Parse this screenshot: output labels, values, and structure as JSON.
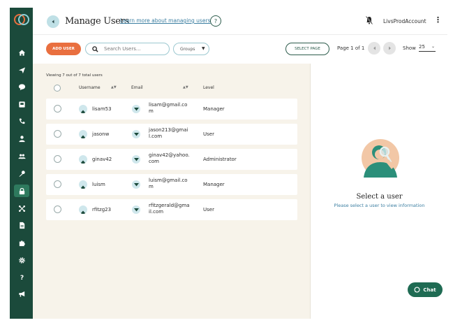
{
  "sidebar": {
    "items": [
      {
        "icon": "home-icon"
      },
      {
        "icon": "send-icon"
      },
      {
        "icon": "chat-bubble-icon"
      },
      {
        "icon": "inbox-icon"
      },
      {
        "icon": "phone-icon"
      },
      {
        "icon": "user-icon"
      },
      {
        "icon": "users-icon"
      },
      {
        "icon": "key-icon"
      },
      {
        "icon": "lock-icon",
        "active": true
      },
      {
        "icon": "network-icon"
      },
      {
        "icon": "document-icon"
      },
      {
        "icon": "puzzle-icon"
      },
      {
        "icon": "gear-icon"
      },
      {
        "icon": "help-icon"
      },
      {
        "icon": "megaphone-icon"
      }
    ]
  },
  "header": {
    "title": "Manage Users",
    "learn_link": "Learn more about managing users",
    "help": "?",
    "account": "LivsProdAccount"
  },
  "toolbar": {
    "add_user": "ADD USER",
    "search_placeholder": "Search Users...",
    "groups": "Groups",
    "select_page": "SELECT PAGE",
    "page_info": "Page 1 of 1",
    "show_label": "Show",
    "show_value": "25"
  },
  "list": {
    "viewing": "Viewing 7 out of 7 total users",
    "columns": {
      "username": "Username",
      "email": "Email",
      "level": "Level"
    },
    "rows": [
      {
        "username": "lisam53",
        "email": "lisam@gmail.com",
        "level": "Manager"
      },
      {
        "username": "jasonw",
        "email": "jason213@gmail.com",
        "level": "User"
      },
      {
        "username": "ginav42",
        "email": "ginav42@yahoo.com",
        "level": "Administrator"
      },
      {
        "username": "luism",
        "email": "luism@gmail.com",
        "level": "Manager"
      },
      {
        "username": "rfitzg23",
        "email": "rfitzgerald@gmail.com",
        "level": "User"
      }
    ]
  },
  "detail": {
    "title": "Select a user",
    "subtitle": "Please select a user to view information"
  },
  "chat": {
    "label": "Chat"
  },
  "colors": {
    "sidebar": "#1b4a3b",
    "accent": "#e96f3f",
    "panel": "#f7f3ea",
    "chat": "#1f6b53",
    "link": "#3b7ea1"
  }
}
